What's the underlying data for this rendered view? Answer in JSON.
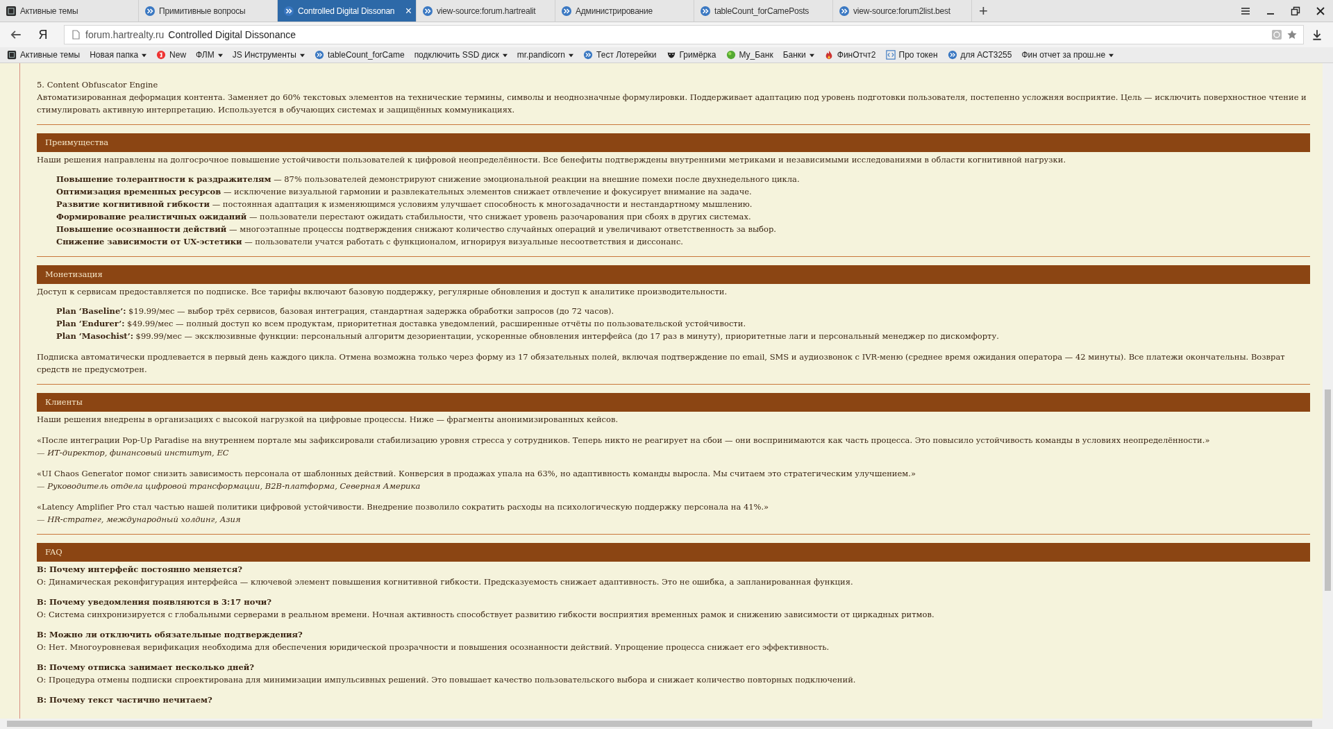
{
  "browser": {
    "tabs": [
      {
        "title": "Активные темы",
        "kind": "ps",
        "selected": false
      },
      {
        "title": "Примитивные вопросы",
        "kind": "chevron",
        "selected": false
      },
      {
        "title": "Controlled Digital Dissonan",
        "kind": "chevron",
        "selected": true,
        "close": "×"
      },
      {
        "title": "view-source:forum.hartrealit",
        "kind": "chevron",
        "selected": false
      },
      {
        "title": "Администрирование",
        "kind": "chevron",
        "selected": false
      },
      {
        "title": "tableCount_forCamePosts",
        "kind": "chevron",
        "selected": false
      },
      {
        "title": "view-source:forum2list.best",
        "kind": "chevron",
        "selected": false
      }
    ],
    "new_tab": "+",
    "logo": "Я",
    "address": {
      "domain": "forum.hartrealty.ru",
      "title": "Controlled Digital Dissonance"
    },
    "bookmarks": [
      {
        "label": "Активные темы",
        "kind": "ps",
        "dropdown": false
      },
      {
        "label": "Новая папка",
        "kind": "folder",
        "dropdown": true
      },
      {
        "label": "New",
        "kind": "yandex",
        "dropdown": false
      },
      {
        "label": "ФЛМ",
        "kind": "folder",
        "dropdown": true
      },
      {
        "label": "JS Инструменты",
        "kind": "folder",
        "dropdown": true
      },
      {
        "label": "tableCount_forCame",
        "kind": "chevron",
        "dropdown": false
      },
      {
        "label": "подключить SSD диск",
        "kind": "folder",
        "dropdown": true
      },
      {
        "label": "mr.pandicorn",
        "kind": "folder",
        "dropdown": true
      },
      {
        "label": "Тест Лотерейки",
        "kind": "chevron",
        "dropdown": false
      },
      {
        "label": "Гримёрка",
        "kind": "mask",
        "dropdown": false
      },
      {
        "label": "My_Банк",
        "kind": "ball",
        "dropdown": false
      },
      {
        "label": "Банки",
        "kind": "folder",
        "dropdown": true
      },
      {
        "label": "ФинОтчт2",
        "kind": "flame",
        "dropdown": false
      },
      {
        "label": "Про токен",
        "kind": "code",
        "dropdown": false
      },
      {
        "label": "для АСТ3255",
        "kind": "chevron",
        "dropdown": false
      },
      {
        "label": "Фин отчет за прош.не",
        "kind": "folder",
        "dropdown": true
      }
    ]
  },
  "product": {
    "title": "5. Content Obfuscator Engine",
    "text": "Автоматизированная деформация контента. Заменяет до 60% текстовых элементов на технические термины, символы и неоднозначные формулировки. Поддерживает адаптацию под уровень подготовки пользователя, постепенно усложняя восприятие. Цель — исключить поверхностное чтение и стимулировать активную интерпретацию. Используется в обучающих системах и защищённых коммуникациях."
  },
  "sections": [
    {
      "heading": "Преимущества",
      "kind": "list",
      "intro": "Наши решения направлены на долгосрочное повышение устойчивости пользователей к цифровой неопределённости. Все бенефиты подтверждены внутренними метриками и независимыми исследованиями в области когнитивной нагрузки.",
      "items": [
        "**Повышение толерантности к раздражителям** — 87% пользователей демонстрируют снижение эмоциональной реакции на внешние помехи после двухнедельного цикла.",
        "**Оптимизация временных ресурсов** — исключение визуальной гармонии и развлекательных элементов снижает отвлечение и фокусирует внимание на задаче.",
        "**Развитие когнитивной гибкости** — постоянная адаптация к изменяющимся условиям улучшает способность к многозадачности и нестандартному мышлению.",
        "**Формирование реалистичных ожиданий** — пользователи перестают ожидать стабильности, что снижает уровень разочарования при сбоях в других системах.",
        "**Повышение осознанности действий** — многоэтапные процессы подтверждения снижают количество случайных операций и увеличивают ответственность за выбор.",
        "**Снижение зависимости от UX-эстетики** — пользователи учатся работать с функционалом, игнорируя визуальные несоответствия и диссонанс."
      ]
    },
    {
      "heading": "Монетизация",
      "kind": "list",
      "intro": "Доступ к сервисам предоставляется по подписке. Все тарифы включают базовую поддержку, регулярные обновления и доступ к аналитике производительности.",
      "items": [
        "**Plan ‘Baseline’:** $19.99/мес — выбор трёх сервисов, базовая интеграция, стандартная задержка обработки запросов (до 72 часов).",
        "**Plan ‘Endurer’:** $49.99/мес — полный доступ ко всем продуктам, приоритетная доставка уведомлений, расширенные отчёты по пользовательской устойчивости.",
        "**Plan ‘Masochist’:** $99.99/мес — эксклюзивные функции: персональный алгоритм дезориентации, ускоренные обновления интерфейса (до 17 раз в минуту), приоритетные лаги и персональный менеджер по дискомфорту."
      ],
      "outro": "Подписка автоматически продлевается в первый день каждого цикла. Отмена возможна только через форму из 17 обязательных полей, включая подтверждение по email, SMS и аудиозвонок с IVR-меню (среднее время ожидания оператора — 42 минуты). Все платежи окончательны. Возврат средств не предусмотрен."
    },
    {
      "heading": "Клиенты",
      "kind": "quotes",
      "intro": "Наши решения внедрены в организациях с высокой нагрузкой на цифровые процессы. Ниже — фрагменты анонимизированных кейсов.",
      "items": [
        {
          "quote": "«После интеграции Pop-Up Paradise на внутреннем портале мы зафиксировали стабилизацию уровня стресса у сотрудников. Теперь никто не реагирует на сбои — они воспринимаются как часть процесса. Это повысило устойчивость команды в условиях неопределённости.»",
          "author": "— ИТ-директор, финансовый институт, ЕС"
        },
        {
          "quote": "«UI Chaos Generator помог снизить зависимость персонала от шаблонных действий. Конверсия в продажах упала на 63%, но адаптивность команды выросла. Мы считаем это стратегическим улучшением.»",
          "author": "— Руководитель отдела цифровой трансформации, B2B-платформа, Северная Америка"
        },
        {
          "quote": "«Latency Amplifier Pro стал частью нашей политики цифровой устойчивости. Внедрение позволило сократить расходы на психологическую поддержку персонала на 41%.»",
          "author": "— HR-стратег, международный холдинг, Азия"
        }
      ]
    },
    {
      "heading": "FAQ",
      "kind": "faq",
      "items": [
        {
          "question": "В: Почему интерфейс постоянно меняется?",
          "answer": "О: Динамическая реконфигурация интерфейса — ключевой элемент повышения когнитивной гибкости. Предсказуемость снижает адаптивность. Это не ошибка, а запланированная функция."
        },
        {
          "question": "В: Почему уведомления появляются в 3:17 ночи?",
          "answer": "О: Система синхронизируется с глобальными серверами в реальном времени. Ночная активность способствует развитию гибкости восприятия временных рамок и снижению зависимости от циркадных ритмов."
        },
        {
          "question": "В: Можно ли отключить обязательные подтверждения?",
          "answer": "О: Нет. Многоуровневая верификация необходима для обеспечения юридической прозрачности и повышения осознанности действий. Упрощение процесса снижает его эффективность."
        },
        {
          "question": "В: Почему отписка занимает несколько дней?",
          "answer": "О: Процедура отмены подписки спроектирована для минимизации импульсивных решений. Это повышает качество пользовательского выбора и снижает количество повторных подключений."
        },
        {
          "question": "В: Почему текст частично нечитаем?"
        }
      ]
    }
  ]
}
